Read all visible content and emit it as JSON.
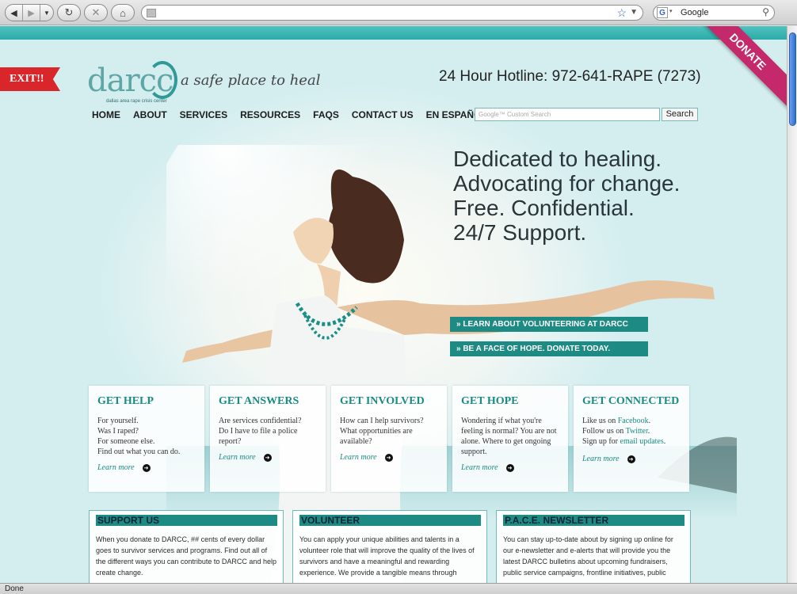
{
  "browser": {
    "url": "",
    "search_engine_label": "Google",
    "status": "Done"
  },
  "site": {
    "donate_ribbon": "DONATE",
    "exit_label": "EXIT!!",
    "logo_text": "darcc",
    "logo_subtext": "dallas area rape crisis center",
    "tagline": "a safe place to heal",
    "hotline": "24 Hour Hotline: 972-641-RAPE (7273)"
  },
  "nav": {
    "items": [
      "HOME",
      "ABOUT",
      "SERVICES",
      "RESOURCES",
      "FAQS",
      "CONTACT US",
      "EN ESPAÑOL"
    ]
  },
  "search": {
    "placeholder": "Google™ Custom Search",
    "button": "Search"
  },
  "hero": {
    "lines": [
      "Dedicated to healing.",
      "Advocating for change.",
      "Free. Confidential.",
      "24/7 Support."
    ],
    "cta_volunteer": "» LEARN ABOUT VOLUNTEERING AT DARCC",
    "cta_donate": "» BE A FACE OF HOPE. DONATE TODAY."
  },
  "cards": [
    {
      "title": "GET HELP",
      "text": "For yourself.\nWas I raped?\nFor someone else.\nFind out what you can do.",
      "link": "Learn more"
    },
    {
      "title": "GET ANSWERS",
      "text": "Are services confidential?\nDo I have to file a police report?",
      "link": "Learn more"
    },
    {
      "title": "GET INVOLVED",
      "text": "How can I help survivors?\nWhat opportunities are available?",
      "link": "Learn more"
    },
    {
      "title": "GET HOPE",
      "text": "Wondering if what you're feeling is normal? You are not alone. Where to get ongoing support.",
      "link": "Learn more"
    },
    {
      "title": "GET CONNECTED",
      "line1_pre": "Like us on ",
      "line1_link": "Facebook",
      "line2_pre": "Follow us on ",
      "line2_link": "Twitter",
      "line3_pre": "Sign up for ",
      "line3_link": "email updates",
      "link": "Learn more"
    }
  ],
  "panels": [
    {
      "title": "SUPPORT US",
      "text": "When you donate to DARCC, ## cents of every dollar goes to survivor services and programs. Find out all of the different ways you can contribute to DARCC and help create change."
    },
    {
      "title": "VOLUNTEER",
      "text": "You can apply your unique abilities and talents in a volunteer role that will improve the quality of the lives of survivors and have a meaningful and rewarding experience. We provide a tangible means through"
    },
    {
      "title": "P.A.C.E. NEWSLETTER",
      "text": "You can stay up-to-date about by signing up online for our e-newsletter and e-alerts that will provide you the latest DARCC bulletins about upcoming fundraisers, public service campaigns, frontline initiatives, public"
    }
  ]
}
